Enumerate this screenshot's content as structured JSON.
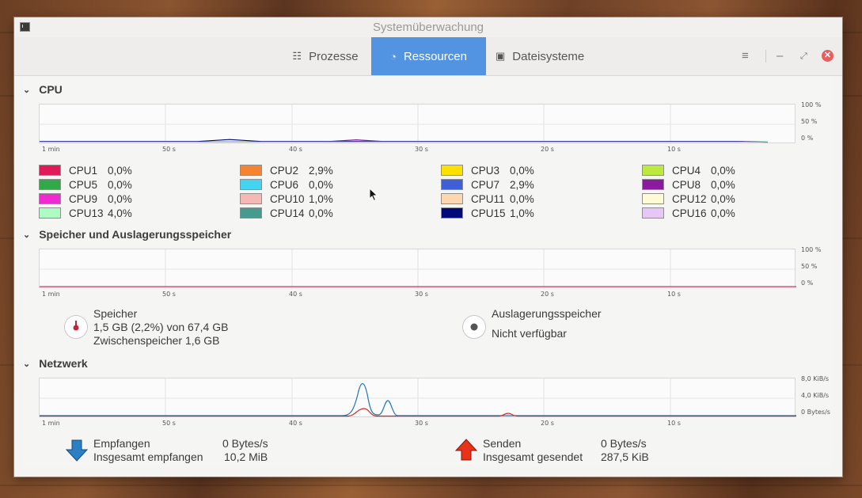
{
  "window": {
    "title": "Systemüberwachung"
  },
  "tabs": [
    {
      "label": "Prozesse",
      "icon": "list-icon",
      "active": false
    },
    {
      "label": "Ressourcen",
      "icon": "gauge-icon",
      "active": true
    },
    {
      "label": "Dateisysteme",
      "icon": "disk-icon",
      "active": false
    }
  ],
  "colors": {
    "accent": "#5294e2",
    "close": "#e85d5d",
    "received": "#1f77b4",
    "sent": "#d62728"
  },
  "x_ticks": [
    "1 min",
    "50 s",
    "40 s",
    "30 s",
    "20 s",
    "10 s"
  ],
  "cpu": {
    "title": "CPU",
    "y_ticks": [
      "100 %",
      "50 %",
      "0 %"
    ],
    "items": [
      {
        "name": "CPU1",
        "value": "0,0%",
        "color": "#e0195a"
      },
      {
        "name": "CPU2",
        "value": "2,9%",
        "color": "#f58431"
      },
      {
        "name": "CPU3",
        "value": "0,0%",
        "color": "#fce100"
      },
      {
        "name": "CPU4",
        "value": "0,0%",
        "color": "#bce840"
      },
      {
        "name": "CPU5",
        "value": "0,0%",
        "color": "#33a84a"
      },
      {
        "name": "CPU6",
        "value": "0,0%",
        "color": "#44d3f0"
      },
      {
        "name": "CPU7",
        "value": "2,9%",
        "color": "#3e5fd6"
      },
      {
        "name": "CPU8",
        "value": "0,0%",
        "color": "#8a1b9d"
      },
      {
        "name": "CPU9",
        "value": "0,0%",
        "color": "#ee2bd1"
      },
      {
        "name": "CPU10",
        "value": "1,0%",
        "color": "#f5b8b5"
      },
      {
        "name": "CPU11",
        "value": "0,0%",
        "color": "#fdd7b0"
      },
      {
        "name": "CPU12",
        "value": "0,0%",
        "color": "#fffbd5"
      },
      {
        "name": "CPU13",
        "value": "4,0%",
        "color": "#aefcc4"
      },
      {
        "name": "CPU14",
        "value": "0,0%",
        "color": "#469a8e"
      },
      {
        "name": "CPU15",
        "value": "1,0%",
        "color": "#000a78"
      },
      {
        "name": "CPU16",
        "value": "0,0%",
        "color": "#e5c8f7"
      }
    ]
  },
  "memory": {
    "title": "Speicher und Auslagerungsspeicher",
    "y_ticks": [
      "100 %",
      "50 %",
      "0 %"
    ],
    "ram_label": "Speicher",
    "ram_value": "1,5 GB (2,2%) von 67,4 GB",
    "cache_value": "Zwischenspeicher 1,6 GB",
    "ram_fraction": 0.022,
    "swap_label": "Auslagerungsspeicher",
    "swap_value": "Nicht verfügbar"
  },
  "network": {
    "title": "Netzwerk",
    "y_ticks": [
      "8,0 KiB/s",
      "4,0 KiB/s",
      "0 Bytes/s"
    ],
    "received_label": "Empfangen",
    "received_rate": "0 Bytes/s",
    "received_total_label": "Insgesamt empfangen",
    "received_total": "10,2 MiB",
    "sent_label": "Senden",
    "sent_rate": "0 Bytes/s",
    "sent_total_label": "Insgesamt gesendet",
    "sent_total": "287,5 KiB"
  }
}
